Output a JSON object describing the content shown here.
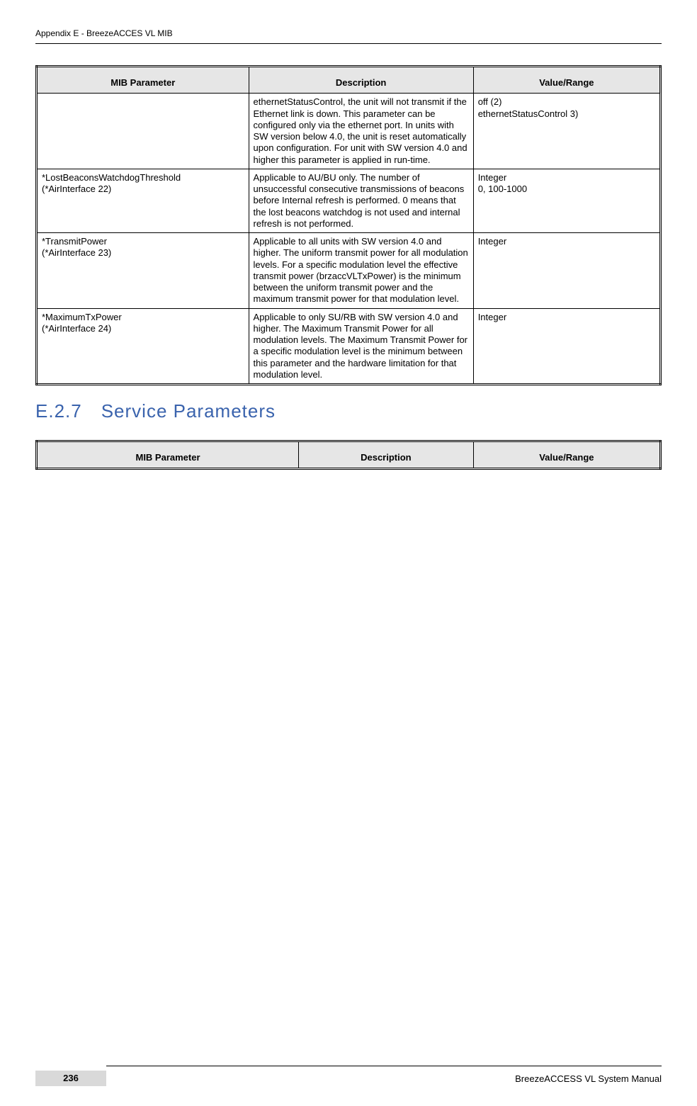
{
  "header": "Appendix E - BreezeACCES VL MIB",
  "table1": {
    "head": {
      "c1": "MIB Parameter",
      "c2": "Description",
      "c3": "Value/Range"
    },
    "rows": [
      {
        "c1": "",
        "c2": "ethernetStatusControl, the unit will not transmit if the Ethernet link is down. This parameter can be configured only via the ethernet port. In units with SW version below 4.0, the unit is reset automatically upon configuration. For unit with SW version 4.0 and higher this parameter is applied in run-time.",
        "c3": "off (2)\nethernetStatusControl 3)"
      },
      {
        "c1": "*LostBeaconsWatchdogThreshold\n(*AirInterface 22)",
        "c2": "Applicable to AU/BU only. The number of unsuccessful consecutive transmissions of beacons before Internal refresh is performed. 0 means that the lost beacons watchdog is not used and internal refresh is not performed.",
        "c3": "Integer\n0, 100-1000"
      },
      {
        "c1": "*TransmitPower\n(*AirInterface 23)",
        "c2": "Applicable to all units with SW version 4.0 and higher.              The uniform transmit power for all modulation levels. For a specific modulation level the effective transmit power (brzaccVLTxPower) is the minimum between the uniform transmit power and the maximum transmit power for that modulation level.",
        "c3": "Integer"
      },
      {
        "c1": "*MaximumTxPower\n(*AirInterface 24)",
        "c2": "Applicable to only SU/RB with SW version 4.0 and higher. The Maximum Transmit Power for all modulation levels. The Maximum Transmit Power for a specific modulation level is the minimum between this parameter and the hardware limitation for  that modulation level.",
        "c3": "Integer"
      }
    ]
  },
  "section_heading": "E.2.7 Service Parameters",
  "table2": {
    "head": {
      "c1": "MIB Parameter",
      "c2": "Description",
      "c3": "Value/Range"
    }
  },
  "footer": {
    "page": "236",
    "title": "BreezeACCESS VL System Manual"
  }
}
